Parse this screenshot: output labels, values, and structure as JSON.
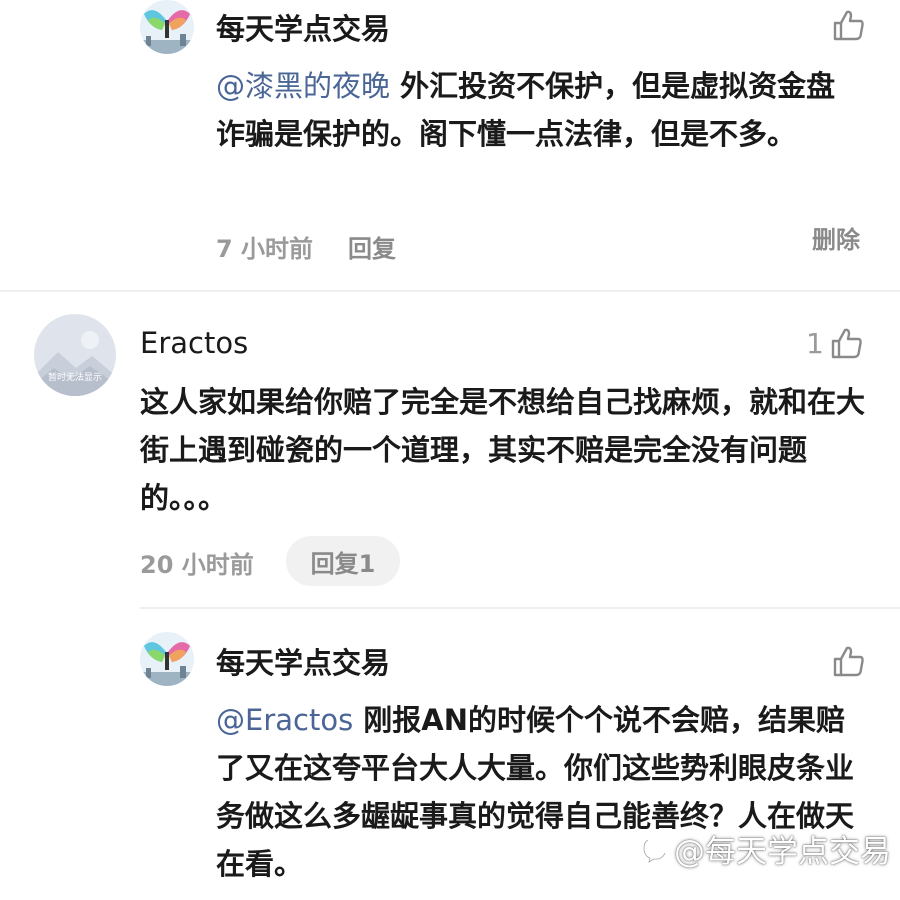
{
  "comments": [
    {
      "author": "每天学点交易",
      "mention": "@漆黑的夜晚",
      "text": " 外汇投资不保护，但是虚拟资金盘诈骗是保护的。阁下懂一点法律，但是不多。",
      "time": "7 小时前",
      "reply_label": "回复",
      "delete_label": "删除"
    },
    {
      "author": "Eractos",
      "like_count": "1",
      "text": "这人家如果给你赔了完全是不想给自己找麻烦，就和在大街上遇到碰瓷的一个道理，其实不赔是完全没有问题的。。。",
      "time": "20 小时前",
      "reply_label": "回复1",
      "avatar_caption": "暂时无法显示"
    },
    {
      "author": "每天学点交易",
      "mention": "@Eractos",
      "text": " 刚报AN的时候个个说不会赔，结果赔了又在这夸平台大人大量。你们这些势利眼皮条业务做这么多龌龊事真的觉得自己能善终？人在做天在看。"
    }
  ],
  "watermark": "@每天学点交易",
  "icons": {
    "like": "thumbs-up-icon",
    "watermark": "zhihu-logo-icon"
  },
  "colors": {
    "mention": "#4a6596",
    "meta": "#9a9a9a",
    "divider": "#efefef"
  }
}
